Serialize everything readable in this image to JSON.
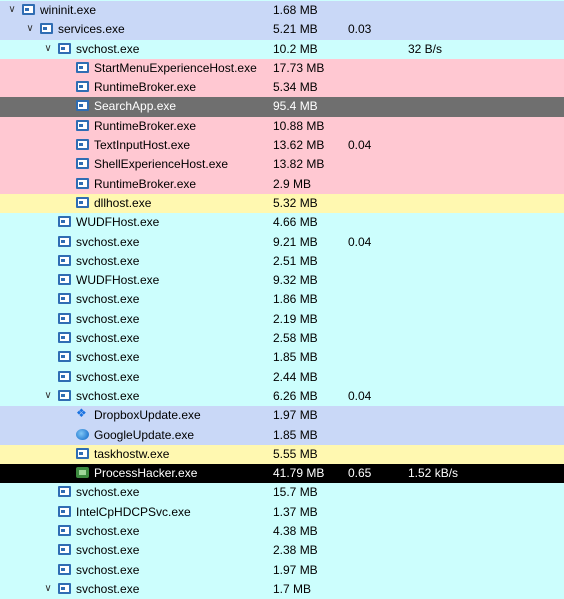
{
  "processes": [
    {
      "name": "wininit.exe",
      "private_bytes": "1.68 MB",
      "cpu": "",
      "io": "",
      "depth": 0,
      "expanded": true,
      "color": "blue",
      "icon": "window-icon"
    },
    {
      "name": "services.exe",
      "private_bytes": "5.21 MB",
      "cpu": "0.03",
      "io": "",
      "depth": 1,
      "expanded": true,
      "color": "blue",
      "icon": "window-icon"
    },
    {
      "name": "svchost.exe",
      "private_bytes": "10.2 MB",
      "cpu": "",
      "io": "32 B/s",
      "depth": 2,
      "expanded": true,
      "color": "cyan",
      "icon": "window-icon"
    },
    {
      "name": "StartMenuExperienceHost.exe",
      "private_bytes": "17.73 MB",
      "cpu": "",
      "io": "",
      "depth": 3,
      "expanded": null,
      "color": "pink",
      "icon": "window-icon"
    },
    {
      "name": "RuntimeBroker.exe",
      "private_bytes": "5.34 MB",
      "cpu": "",
      "io": "",
      "depth": 3,
      "expanded": null,
      "color": "pink",
      "icon": "window-icon"
    },
    {
      "name": "SearchApp.exe",
      "private_bytes": "95.4 MB",
      "cpu": "",
      "io": "",
      "depth": 3,
      "expanded": null,
      "color": "gray",
      "icon": "window-icon"
    },
    {
      "name": "RuntimeBroker.exe",
      "private_bytes": "10.88 MB",
      "cpu": "",
      "io": "",
      "depth": 3,
      "expanded": null,
      "color": "pink",
      "icon": "window-icon"
    },
    {
      "name": "TextInputHost.exe",
      "private_bytes": "13.62 MB",
      "cpu": "0.04",
      "io": "",
      "depth": 3,
      "expanded": null,
      "color": "pink",
      "icon": "window-icon"
    },
    {
      "name": "ShellExperienceHost.exe",
      "private_bytes": "13.82 MB",
      "cpu": "",
      "io": "",
      "depth": 3,
      "expanded": null,
      "color": "pink",
      "icon": "window-icon"
    },
    {
      "name": "RuntimeBroker.exe",
      "private_bytes": "2.9 MB",
      "cpu": "",
      "io": "",
      "depth": 3,
      "expanded": null,
      "color": "pink",
      "icon": "window-icon"
    },
    {
      "name": "dllhost.exe",
      "private_bytes": "5.32 MB",
      "cpu": "",
      "io": "",
      "depth": 3,
      "expanded": null,
      "color": "yellow",
      "icon": "window-icon"
    },
    {
      "name": "WUDFHost.exe",
      "private_bytes": "4.66 MB",
      "cpu": "",
      "io": "",
      "depth": 2,
      "expanded": null,
      "color": "cyan",
      "icon": "window-icon"
    },
    {
      "name": "svchost.exe",
      "private_bytes": "9.21 MB",
      "cpu": "0.04",
      "io": "",
      "depth": 2,
      "expanded": null,
      "color": "cyan",
      "icon": "window-icon"
    },
    {
      "name": "svchost.exe",
      "private_bytes": "2.51 MB",
      "cpu": "",
      "io": "",
      "depth": 2,
      "expanded": null,
      "color": "cyan",
      "icon": "window-icon"
    },
    {
      "name": "WUDFHost.exe",
      "private_bytes": "9.32 MB",
      "cpu": "",
      "io": "",
      "depth": 2,
      "expanded": null,
      "color": "cyan",
      "icon": "window-icon"
    },
    {
      "name": "svchost.exe",
      "private_bytes": "1.86 MB",
      "cpu": "",
      "io": "",
      "depth": 2,
      "expanded": null,
      "color": "cyan",
      "icon": "window-icon"
    },
    {
      "name": "svchost.exe",
      "private_bytes": "2.19 MB",
      "cpu": "",
      "io": "",
      "depth": 2,
      "expanded": null,
      "color": "cyan",
      "icon": "window-icon"
    },
    {
      "name": "svchost.exe",
      "private_bytes": "2.58 MB",
      "cpu": "",
      "io": "",
      "depth": 2,
      "expanded": null,
      "color": "cyan",
      "icon": "window-icon"
    },
    {
      "name": "svchost.exe",
      "private_bytes": "1.85 MB",
      "cpu": "",
      "io": "",
      "depth": 2,
      "expanded": null,
      "color": "cyan",
      "icon": "window-icon"
    },
    {
      "name": "svchost.exe",
      "private_bytes": "2.44 MB",
      "cpu": "",
      "io": "",
      "depth": 2,
      "expanded": null,
      "color": "cyan",
      "icon": "window-icon"
    },
    {
      "name": "svchost.exe",
      "private_bytes": "6.26 MB",
      "cpu": "0.04",
      "io": "",
      "depth": 2,
      "expanded": true,
      "color": "cyan",
      "icon": "window-icon"
    },
    {
      "name": "DropboxUpdate.exe",
      "private_bytes": "1.97 MB",
      "cpu": "",
      "io": "",
      "depth": 3,
      "expanded": null,
      "color": "blue",
      "icon": "dropbox-icon"
    },
    {
      "name": "GoogleUpdate.exe",
      "private_bytes": "1.85 MB",
      "cpu": "",
      "io": "",
      "depth": 3,
      "expanded": null,
      "color": "blue",
      "icon": "google-update-icon"
    },
    {
      "name": "taskhostw.exe",
      "private_bytes": "5.55 MB",
      "cpu": "",
      "io": "",
      "depth": 3,
      "expanded": null,
      "color": "yellow",
      "icon": "window-icon"
    },
    {
      "name": "ProcessHacker.exe",
      "private_bytes": "41.79 MB",
      "cpu": "0.65",
      "io": "1.52 kB/s",
      "depth": 3,
      "expanded": null,
      "color": "black",
      "icon": "process-hacker-icon"
    },
    {
      "name": "svchost.exe",
      "private_bytes": "15.7 MB",
      "cpu": "",
      "io": "",
      "depth": 2,
      "expanded": null,
      "color": "cyan",
      "icon": "window-icon"
    },
    {
      "name": "IntelCpHDCPSvc.exe",
      "private_bytes": "1.37 MB",
      "cpu": "",
      "io": "",
      "depth": 2,
      "expanded": null,
      "color": "cyan",
      "icon": "window-icon"
    },
    {
      "name": "svchost.exe",
      "private_bytes": "4.38 MB",
      "cpu": "",
      "io": "",
      "depth": 2,
      "expanded": null,
      "color": "cyan",
      "icon": "window-icon"
    },
    {
      "name": "svchost.exe",
      "private_bytes": "2.38 MB",
      "cpu": "",
      "io": "",
      "depth": 2,
      "expanded": null,
      "color": "cyan",
      "icon": "window-icon"
    },
    {
      "name": "svchost.exe",
      "private_bytes": "1.97 MB",
      "cpu": "",
      "io": "",
      "depth": 2,
      "expanded": null,
      "color": "cyan",
      "icon": "window-icon"
    },
    {
      "name": "svchost.exe",
      "private_bytes": "1.7 MB",
      "cpu": "",
      "io": "",
      "depth": 2,
      "expanded": true,
      "color": "cyan",
      "icon": "window-icon"
    }
  ],
  "colors": {
    "blue": "#c9d8f7",
    "cyan": "#ccfefd",
    "pink": "#ffc8d2",
    "gray": "#6f6f6f",
    "yellow": "#fff8b0",
    "black": "#000000"
  }
}
